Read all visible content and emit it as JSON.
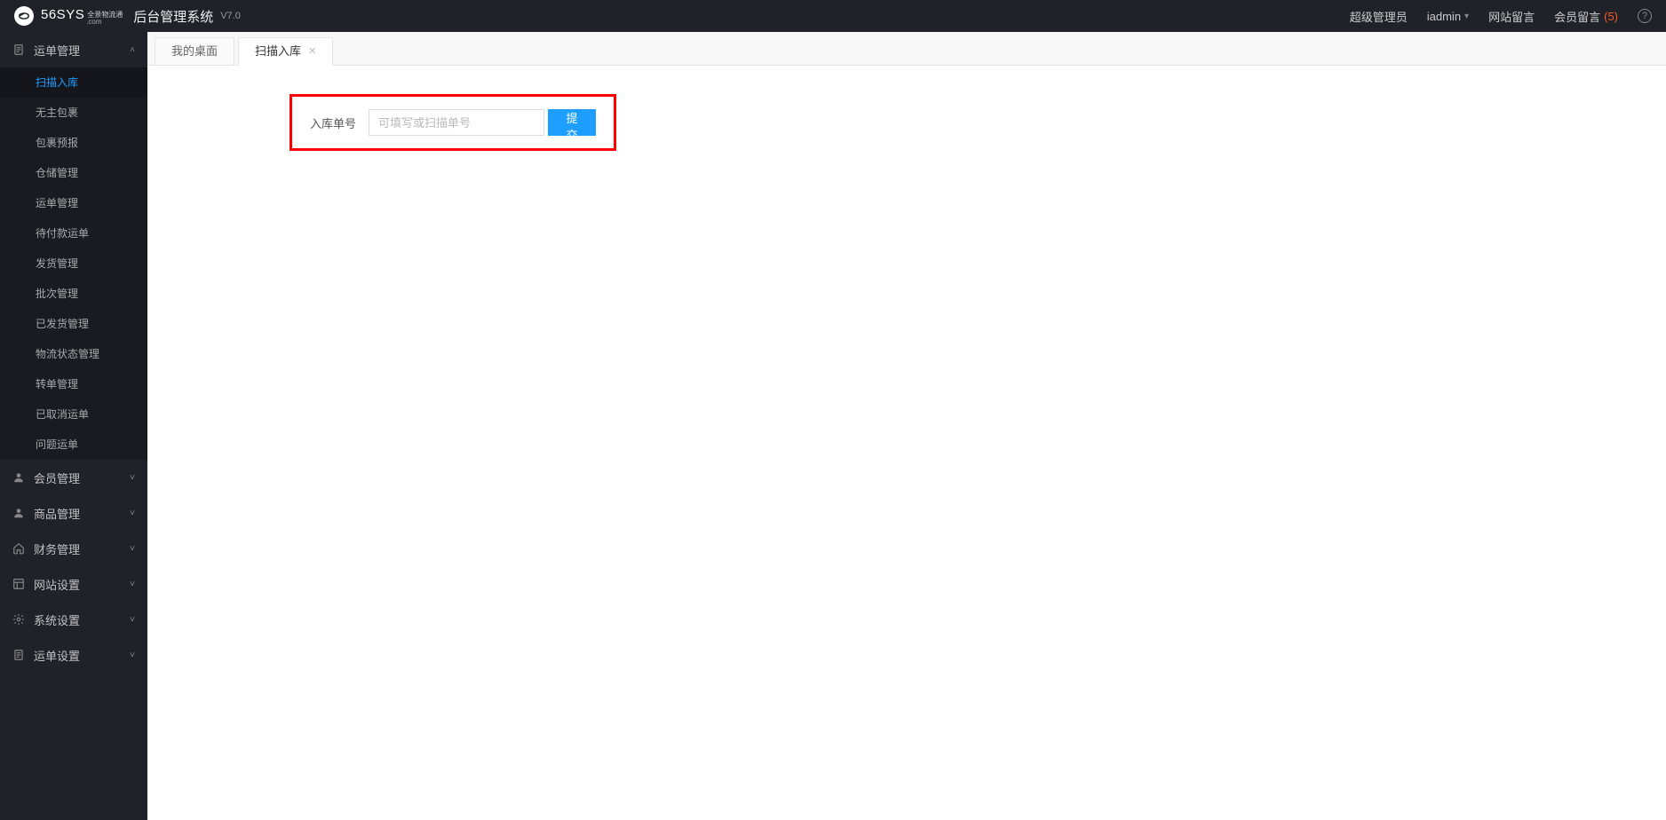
{
  "header": {
    "logo_main": "56SYS",
    "logo_sub1": "全景物流通",
    "logo_sub2": ".com",
    "system_name": "后台管理系统",
    "version": "V7.0",
    "role_label": "超级管理员",
    "user_name": "iadmin",
    "site_msg_label": "网站留言",
    "member_msg_label": "会员留言",
    "member_msg_count": "(5)"
  },
  "sidebar": {
    "groups": [
      {
        "label": "运单管理",
        "icon": "doc",
        "expanded": true,
        "items": [
          {
            "label": "扫描入库",
            "active": true
          },
          {
            "label": "无主包裹"
          },
          {
            "label": "包裹预报"
          },
          {
            "label": "仓储管理"
          },
          {
            "label": "运单管理"
          },
          {
            "label": "待付款运单"
          },
          {
            "label": "发货管理"
          },
          {
            "label": "批次管理"
          },
          {
            "label": "已发货管理"
          },
          {
            "label": "物流状态管理"
          },
          {
            "label": "转单管理"
          },
          {
            "label": "已取消运单"
          },
          {
            "label": "问题运单"
          }
        ]
      },
      {
        "label": "会员管理",
        "icon": "user"
      },
      {
        "label": "商品管理",
        "icon": "user"
      },
      {
        "label": "财务管理",
        "icon": "home"
      },
      {
        "label": "网站设置",
        "icon": "layout"
      },
      {
        "label": "系统设置",
        "icon": "gear"
      },
      {
        "label": "运单设置",
        "icon": "doc"
      }
    ]
  },
  "tabs": [
    {
      "label": "我的桌面",
      "closable": false,
      "active": false
    },
    {
      "label": "扫描入库",
      "closable": true,
      "active": true
    }
  ],
  "form": {
    "label": "入库单号",
    "placeholder": "可填写或扫描单号",
    "submit": "提交"
  }
}
